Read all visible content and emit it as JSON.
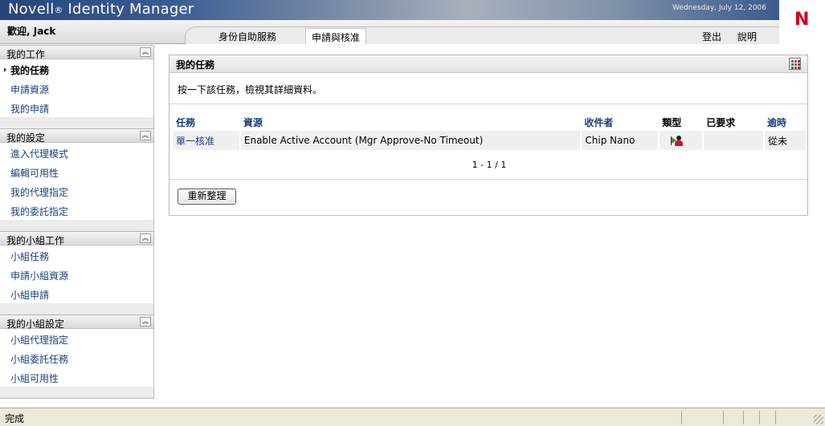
{
  "header": {
    "brand": "Novell",
    "brand_mark": "®",
    "product": " Identity Manager",
    "date": "Wednesday, July 12, 2006",
    "logo_letter": "N",
    "welcome": "歡迎, Jack"
  },
  "tabs": [
    {
      "label": "身份自助服務",
      "active": false
    },
    {
      "label": "申請與核准",
      "active": true
    }
  ],
  "header_links": {
    "logout": "登出",
    "help": "說明"
  },
  "sidebar": {
    "groups": [
      {
        "title": "我的工作",
        "items": [
          "我的任務",
          "申請資源",
          "我的申請"
        ],
        "current": 0
      },
      {
        "title": "我的設定",
        "items": [
          "進入代理模式",
          "編輯可用性",
          "我的代理指定",
          "我的委託指定"
        ]
      },
      {
        "title": "我的小組工作",
        "items": [
          "小組任務",
          "申請小組資源",
          "小組申請"
        ]
      },
      {
        "title": "我的小組設定",
        "items": [
          "小組代理指定",
          "小組委託任務",
          "小組可用性"
        ]
      }
    ]
  },
  "panel": {
    "title": "我的任務",
    "instructions": "按一下該任務，檢視其詳細資料。",
    "columns": {
      "task": "任務",
      "resource": "資源",
      "recipient": "收件者",
      "type": "類型",
      "requested": "已要求",
      "timeout": "逾時"
    },
    "rows": [
      {
        "task": "單一核准",
        "resource": "Enable Active Account (Mgr Approve-No Timeout)",
        "recipient": "Chip Nano",
        "type_icon": "user-approval-icon",
        "requested": "",
        "timeout": "從未"
      }
    ],
    "pager": "1 - 1 / 1",
    "refresh_label": "重新整理"
  },
  "status": {
    "text": "完成"
  },
  "colors": {
    "link": "#1d3f7f",
    "brand_bar": "#3a5c93",
    "logo_red": "#d0021b",
    "row_bg": "#f0f0f0"
  }
}
